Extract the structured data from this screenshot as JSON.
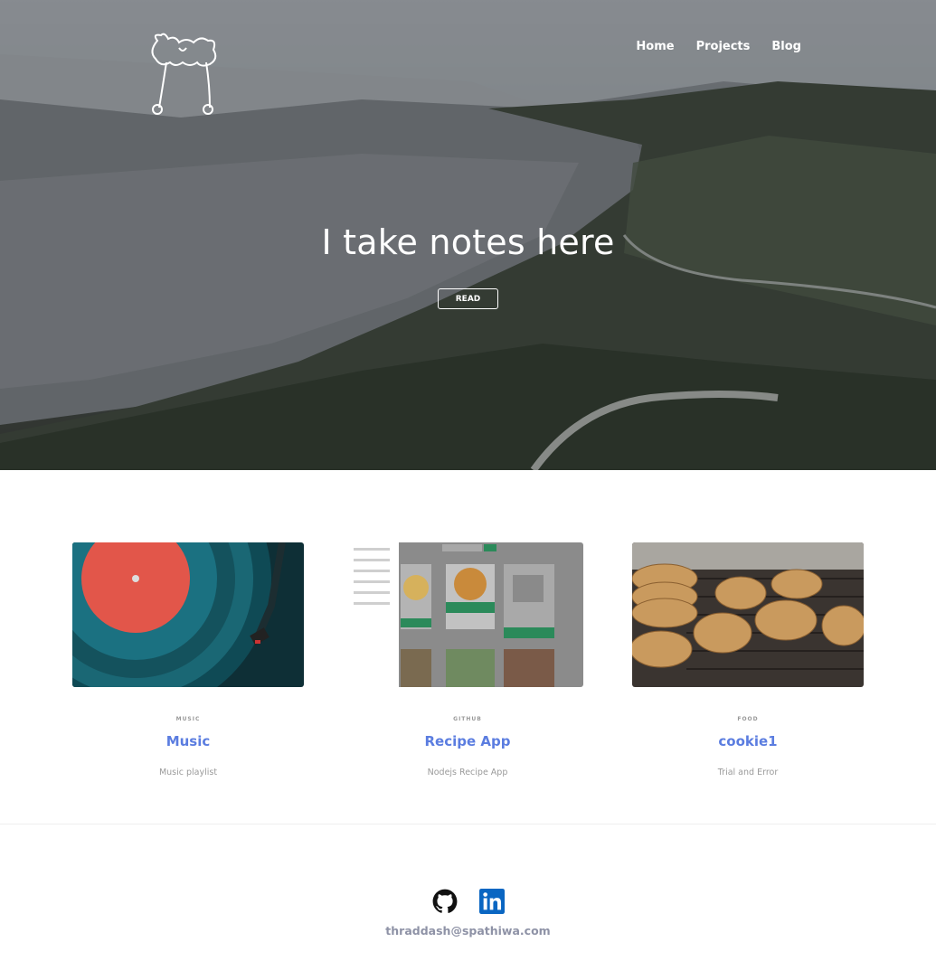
{
  "nav": {
    "items": [
      {
        "label": "Home"
      },
      {
        "label": "Projects"
      },
      {
        "label": "Blog"
      }
    ]
  },
  "hero": {
    "title": "I take notes here",
    "button_label": "READ"
  },
  "cards": [
    {
      "category": "MUSIC",
      "title": "Music",
      "description": "Music playlist",
      "image": "vinyl-record-image"
    },
    {
      "category": "GITHUB",
      "title": "Recipe App",
      "description": "Nodejs Recipe App",
      "image": "recipe-app-screenshot"
    },
    {
      "category": "FOOD",
      "title": "cookie1",
      "description": "Trial and Error",
      "image": "cookies-on-rack-image"
    }
  ],
  "footer": {
    "icons": [
      "github-icon",
      "linkedin-icon"
    ],
    "email": "thraddash@spathiwa.com"
  },
  "colors": {
    "link_title": "#5b7de0",
    "linkedin": "#0a66c2",
    "email": "#8e92a6"
  }
}
